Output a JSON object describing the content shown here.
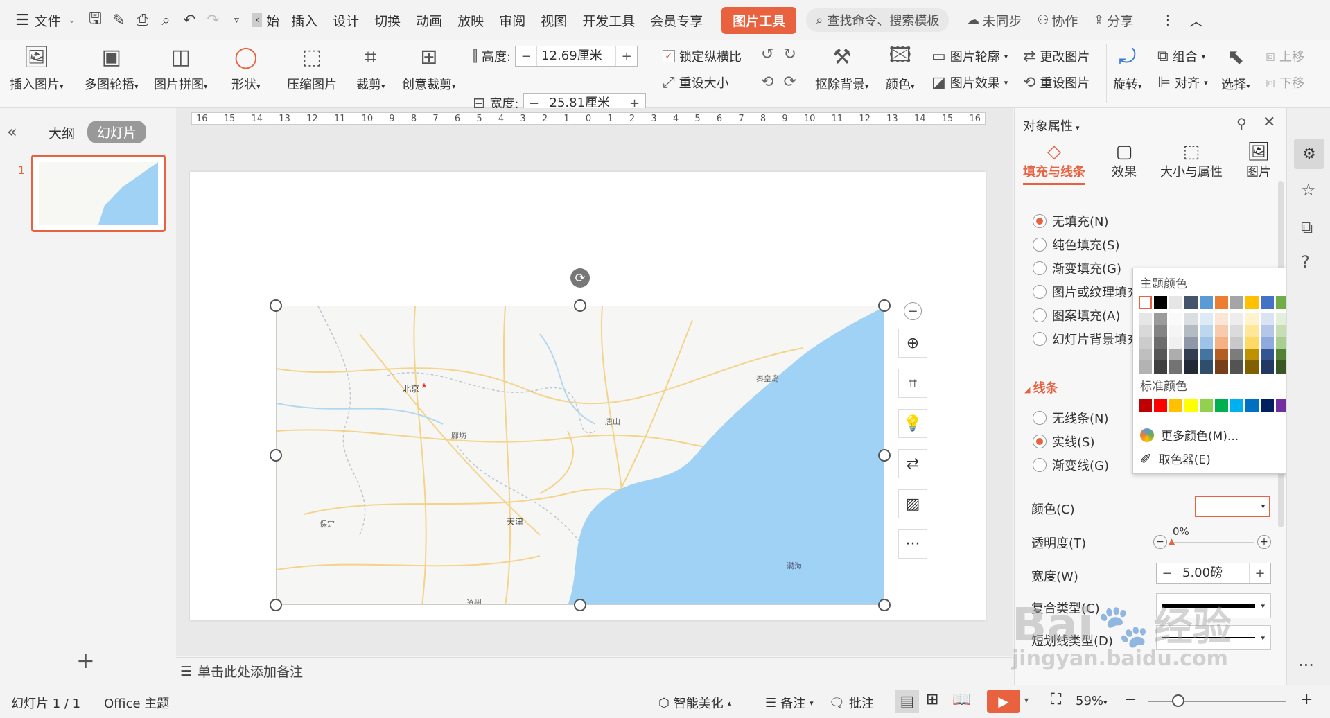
{
  "menubar": {
    "file_label": "文件",
    "tab_fragment": "始",
    "tabs": [
      "插入",
      "设计",
      "切换",
      "动画",
      "放映",
      "审阅",
      "视图",
      "开发工具",
      "会员专享"
    ],
    "active_tab": "图片工具",
    "search_placeholder": "查找命令、搜索模板",
    "unsynced": "未同步",
    "collab": "协作",
    "share": "分享"
  },
  "ribbon": {
    "insert_picture": "插入图片",
    "multi_carousel": "多图轮播",
    "picture_collage": "图片拼图",
    "shape": "形状",
    "compress": "压缩图片",
    "crop": "裁剪",
    "creative_crop": "创意裁剪",
    "height_label": "高度:",
    "height_value": "12.69厘米",
    "width_label": "宽度:",
    "width_value": "25.81厘米",
    "lock_ratio": "锁定纵横比",
    "reset_size": "重设大小",
    "remove_bg": "抠除背景",
    "color": "颜色",
    "picture_outline": "图片轮廓",
    "picture_effect": "图片效果",
    "change_picture": "更改图片",
    "reset_picture": "重设图片",
    "rotate": "旋转",
    "group": "组合",
    "align": "对齐",
    "select": "选择",
    "bring_forward": "上移",
    "send_backward": "下移",
    "minus": "−",
    "plus": "+"
  },
  "left_panel": {
    "outline_tab": "大纲",
    "slides_tab": "幻灯片",
    "slide_number": "1",
    "add_slide": "+"
  },
  "editor": {
    "ruler_labels": [
      "16",
      "15",
      "14",
      "13",
      "12",
      "11",
      "10",
      "9",
      "8",
      "7",
      "6",
      "5",
      "4",
      "3",
      "2",
      "1",
      "0",
      "1",
      "2",
      "3",
      "4",
      "5",
      "6",
      "7",
      "8",
      "9",
      "10",
      "11",
      "12",
      "13",
      "14",
      "15",
      "16"
    ],
    "notes_placeholder": "单击此处添加备注",
    "map_labels": {
      "beijing": "北京",
      "tianjin": "天津",
      "langfang": "廊坊",
      "tangshan": "唐山",
      "baoding": "保定",
      "qinhuangdao": "秦皇岛",
      "bohai": "渤海",
      "cangzhou": "沧州"
    },
    "float_more": "···"
  },
  "right_panel": {
    "title": "对象属性",
    "tabs": [
      "填充与线条",
      "效果",
      "大小与属性",
      "图片"
    ],
    "fill_options": [
      "无填充(N)",
      "纯色填充(S)",
      "渐变填充(G)",
      "图片或纹理填充",
      "图案填充(A)",
      "幻灯片背景填充"
    ],
    "line_section": "线条",
    "line_options": [
      "无线条(N)",
      "实线(S)",
      "渐变线(G)"
    ],
    "color_label": "颜色(C)",
    "transparency_label": "透明度(T)",
    "transparency_value": "0%",
    "width_label": "宽度(W)",
    "width_value": "5.00磅",
    "compound_label": "复合类型(C)",
    "dash_label": "短划线类型(D)"
  },
  "color_popup": {
    "theme_title": "主题颜色",
    "standard_title": "标准颜色",
    "more_colors": "更多颜色(M)...",
    "eyedropper": "取色器(E)",
    "theme_top": [
      "#ffffff",
      "#000000",
      "#e7e6e6",
      "#44546a",
      "#5b9bd5",
      "#ed7d31",
      "#a5a5a5",
      "#ffc000",
      "#4472c4",
      "#70ad47"
    ],
    "standard": [
      "#c00000",
      "#ff0000",
      "#ffc000",
      "#ffff00",
      "#92d050",
      "#00b050",
      "#00b0f0",
      "#0070c0",
      "#002060",
      "#7030a0"
    ]
  },
  "status": {
    "slide_info": "幻灯片 1 / 1",
    "theme": "Office 主题",
    "beautify": "智能美化",
    "notes": "备注",
    "comments": "批注",
    "zoom": "59%",
    "zoom_fraction": 0.59
  },
  "watermark": {
    "text1": "Bai",
    "text2": "经验",
    "url": "jingyan.baidu.com"
  }
}
